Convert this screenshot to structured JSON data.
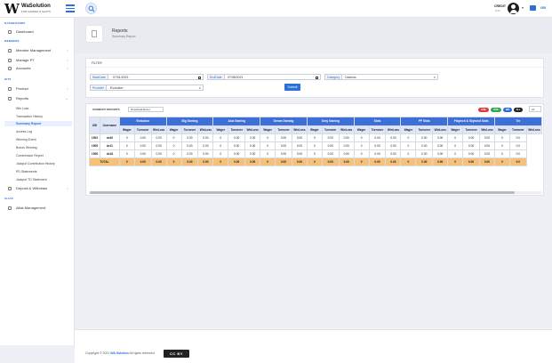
{
  "brand": {
    "mark": "W",
    "name": "WaSolution",
    "tagline": "FOR GAMING & SLOTS"
  },
  "user": {
    "name": "CREDIT",
    "role": "0.00",
    "lang": "GB"
  },
  "sidebar": {
    "sec_dashboards": "DASHBOARDS",
    "dashboard": "Dashboard",
    "sec_members": "MEMBERS",
    "member_management": "Member Management",
    "manage_pt": "Manage PT",
    "accounts": "Accounts",
    "sec_hits": "HITS",
    "product": "Product",
    "reports": "Reports",
    "subs": [
      "Win Loss",
      "Transaction History",
      "Summary Report",
      "Access Log",
      "Winning Event",
      "Bonus Winning",
      "Commission Report",
      "Jackpot Contribution History",
      "PD Statements",
      "Jackpot TD Statement"
    ],
    "deposit": "Deposit & Withdraw",
    "sec_alias": "ALIAS",
    "alias_management": "Alias Management"
  },
  "header": {
    "title": "Reports",
    "subtitle": "Summary Report"
  },
  "filter": {
    "title": "FILTER",
    "start_label": "StartDate",
    "start_value": "07/01/2021",
    "end_label": "EndDate",
    "end_value": "07/08/2021",
    "category_label": "Category",
    "category_value": "Casinos",
    "provider_label": "Provider",
    "provider_value": "Evolution",
    "submit": "Submit"
  },
  "summary": {
    "title": "SUMMARY REPORTS",
    "download_value": "Download Excel",
    "pills": [
      {
        "label": "SOK",
        "color": "#e03b3b"
      },
      {
        "label": "OSK",
        "color": "#2fa84f"
      },
      {
        "label": "WB",
        "color": "#2d6fd6"
      },
      {
        "label": "ALL",
        "color": "#222222"
      }
    ],
    "per_page": "10",
    "lead_headers": [
      "UID",
      "Username"
    ],
    "groups": [
      "Evolution",
      "Big Gaming",
      "Asia Gaming",
      "Dream Gaming",
      "Sexy Gaming",
      "Slots",
      "PP Slots",
      "Playtech & Skywind Slots",
      "Ter"
    ],
    "sub_headers": [
      "Wager",
      "Turnover",
      "WinLoss"
    ],
    "rows": [
      {
        "uid": "1503",
        "username": "dc40",
        "cells": [
          "0",
          "0.00",
          "0.00",
          "0",
          "0.00",
          "0.00",
          "0",
          "0.00",
          "0.00",
          "0",
          "0.00",
          "0.00",
          "0",
          "0.00",
          "0.00",
          "0",
          "0.00",
          "0.00",
          "0",
          "0.00",
          "0.00",
          "0",
          "0.00",
          "0.00",
          "0",
          "0.0"
        ]
      },
      {
        "uid": "1505",
        "username": "dc11",
        "cells": [
          "0",
          "0.00",
          "0.00",
          "0",
          "0.00",
          "0.00",
          "0",
          "0.00",
          "0.00",
          "0",
          "0.00",
          "0.00",
          "0",
          "0.00",
          "0.00",
          "0",
          "0.00",
          "0.00",
          "0",
          "0.00",
          "0.00",
          "0",
          "0.00",
          "0.00",
          "0",
          "0.0"
        ]
      },
      {
        "uid": "1508",
        "username": "dc18",
        "cells": [
          "0",
          "0.00",
          "0.00",
          "0",
          "0.00",
          "0.00",
          "0",
          "0.00",
          "0.00",
          "0",
          "0.00",
          "0.00",
          "0",
          "0.00",
          "0.00",
          "0",
          "0.00",
          "0.00",
          "0",
          "0.00",
          "0.00",
          "0",
          "0.00",
          "0.00",
          "0",
          "0.0"
        ]
      }
    ],
    "total": {
      "label": "TOTAL",
      "cells": [
        "0",
        "0.00",
        "0.00",
        "0",
        "0.00",
        "0.00",
        "0",
        "0.00",
        "0.00",
        "0",
        "0.00",
        "0.00",
        "0",
        "0.00",
        "0.00",
        "0",
        "0.00",
        "0.00",
        "0",
        "0.00",
        "0.00",
        "0",
        "0.00",
        "0.00",
        "0",
        "0.0"
      ]
    }
  },
  "footer": {
    "prefix": "Copyright © 2021",
    "brand": "WA Solution",
    "suffix": "All rights reserved.",
    "license": "CC BY"
  }
}
